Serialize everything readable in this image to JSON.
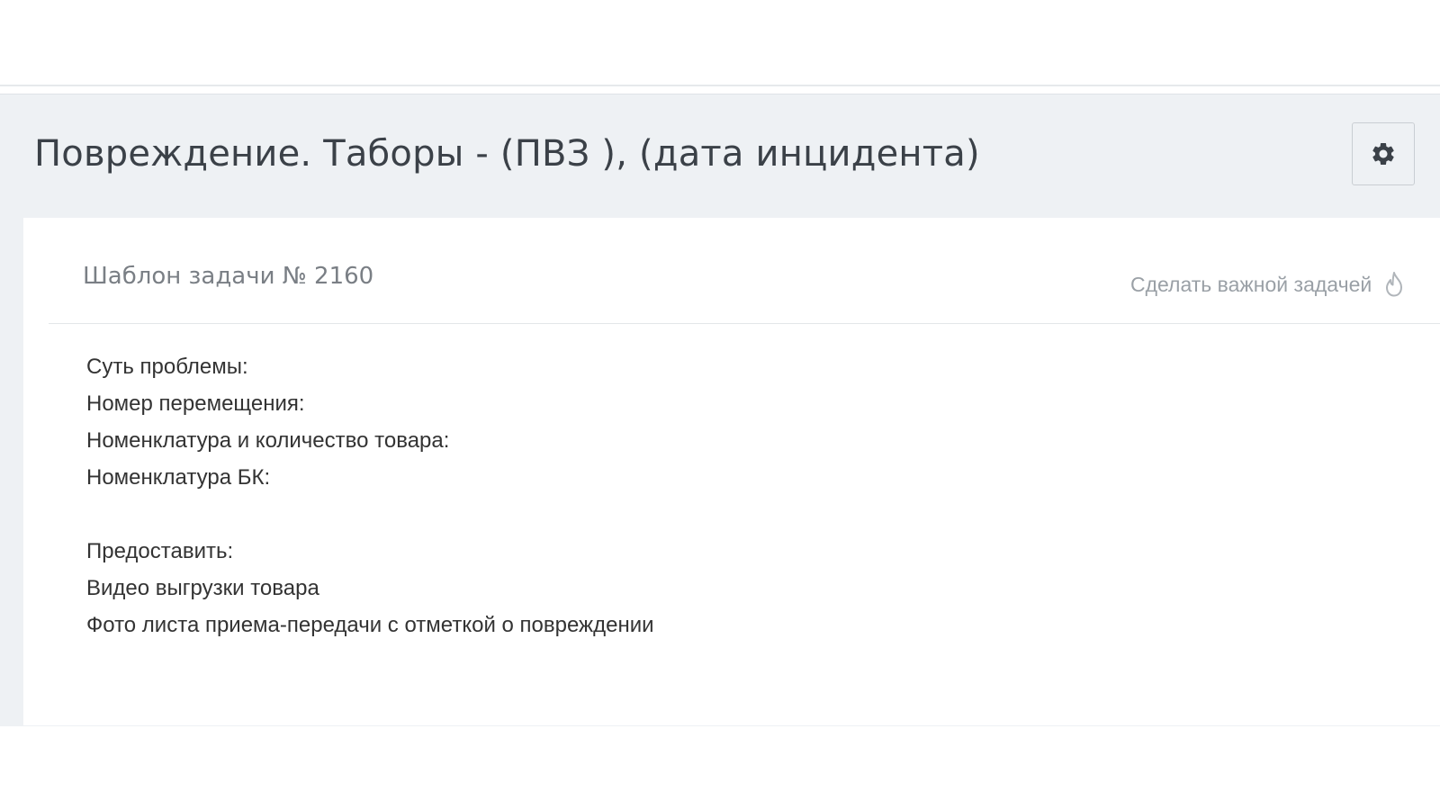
{
  "header": {
    "title": "Повреждение. Таборы - (ПВЗ ), (дата инцидента)",
    "settings_icon": "gear-icon"
  },
  "task": {
    "template_label": "Шаблон задачи № 2160",
    "important_label": "Сделать важной задачей",
    "important_icon": "flame-icon",
    "body_lines": [
      "Суть проблемы:",
      "Номер перемещения:",
      "Номенклатура и количество товара:",
      "Номенклатура БК:",
      "",
      "Предоставить:",
      "Видео выгрузки товара",
      "Фото листа приема-передачи с отметкой о повреждении"
    ]
  },
  "colors": {
    "page_background": "#eef1f4",
    "card_background": "#ffffff",
    "title_text": "#3b4148",
    "muted_text": "#9aa0a6"
  }
}
